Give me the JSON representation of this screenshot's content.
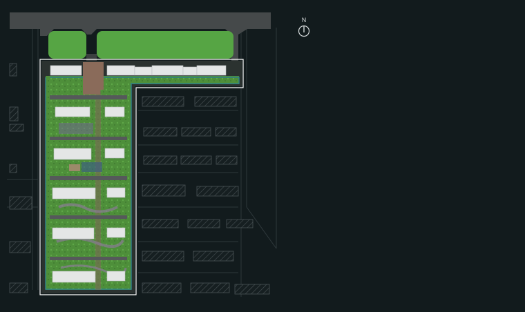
{
  "compass": {
    "label": "N",
    "icon": "north-arrow-icon"
  },
  "colors": {
    "background": "#121b1d",
    "road": "#45494a",
    "lawn": "#56a544",
    "garden": "#4e8f3a",
    "building": "#e4e6e6",
    "site_boundary": "#ffffff",
    "paving": "#8a6b5a",
    "hatch": "#4a5356",
    "linework": "#2f393c"
  }
}
